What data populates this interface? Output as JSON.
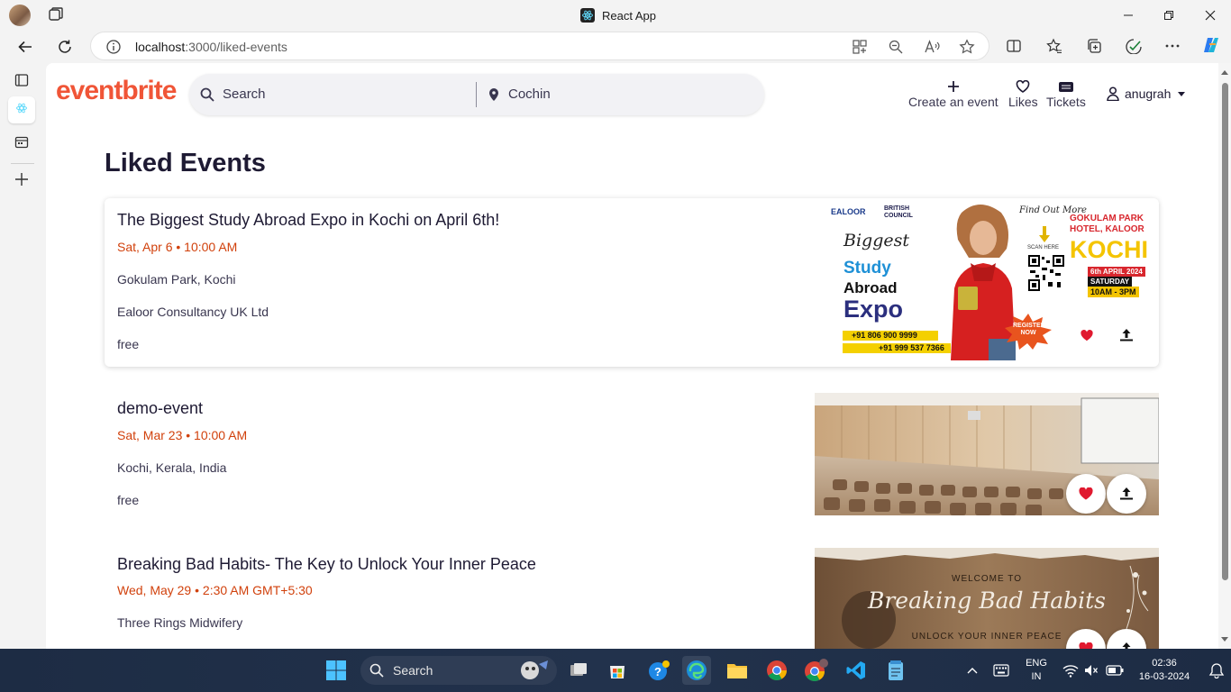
{
  "browser": {
    "tab_title": "React App",
    "url_host": "localhost",
    "url_path": ":3000/liked-events"
  },
  "app": {
    "logo": "eventbrite",
    "search_placeholder": "Search",
    "location": "Cochin",
    "create_event": "Create an event",
    "likes": "Likes",
    "tickets": "Tickets",
    "username": "anugrah"
  },
  "page": {
    "title": "Liked Events"
  },
  "events": [
    {
      "title": "The Biggest Study Abroad Expo in Kochi on April 6th!",
      "date": "Sat, Apr 6 • 10:00 AM",
      "lines": [
        "Gokulam Park, Kochi",
        "Ealoor Consultancy UK Ltd",
        "free"
      ]
    },
    {
      "title": "demo-event",
      "date": "Sat, Mar 23 • 10:00 AM",
      "lines": [
        "Kochi, Kerala, India",
        "free"
      ]
    },
    {
      "title": "Breaking Bad Habits- The Key to Unlock Your Inner Peace",
      "date": "Wed, May 29 • 2:30 AM GMT+5:30",
      "lines": [
        "Three Rings Midwifery"
      ]
    }
  ],
  "poster1": {
    "brand1": "EALOOR",
    "brand2": "BRITISH COUNCIL",
    "find_out": "Find Out More",
    "scan_here": "SCAN HERE",
    "venue": "GOKULAM PARK HOTEL, KALOOR",
    "city": "KOCHI",
    "date": "6th APRIL 2024",
    "day": "SATURDAY",
    "time": "10AM - 3PM",
    "biggest": "Biggest",
    "study": "Study",
    "abroad": "Abroad",
    "expo": "Expo",
    "phone1": "+91 806 900 9999",
    "phone2": "+91 999 537 7366",
    "register": "REGISTER NOW"
  },
  "poster3": {
    "welcome": "WELCOME TO",
    "title": "Breaking Bad Habits",
    "subtitle": "UNLOCK YOUR INNER PEACE"
  },
  "taskbar": {
    "search": "Search",
    "lang1": "ENG",
    "lang2": "IN",
    "time": "02:36",
    "date": "16-03-2024"
  },
  "colors": {
    "brand": "#f05537",
    "date_red": "#d1410c",
    "heart": "#e0192f"
  }
}
